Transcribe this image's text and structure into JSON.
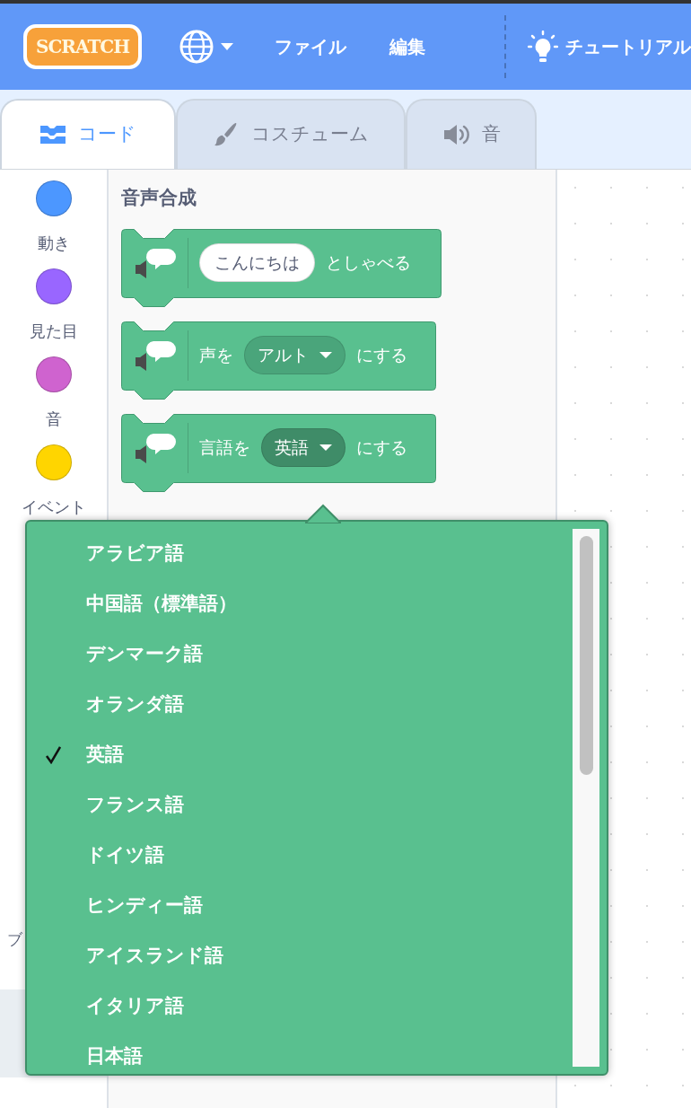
{
  "menu_bar": {
    "logo": "SCRATCH",
    "items": [
      {
        "kind": "language"
      },
      {
        "kind": "text",
        "label": "ファイル"
      },
      {
        "kind": "text",
        "label": "編集"
      },
      {
        "kind": "divider"
      },
      {
        "kind": "tutorial",
        "label": "チュートリアル"
      }
    ]
  },
  "tabs": [
    {
      "label": "コード",
      "kind": "code",
      "selected": true
    },
    {
      "label": "コスチューム",
      "kind": "costume",
      "selected": false
    },
    {
      "label": "音",
      "kind": "sound",
      "selected": false
    }
  ],
  "categories": [
    {
      "label": "動き",
      "color": "#4c97ff",
      "selected": false
    },
    {
      "label": "見た目",
      "color": "#9966ff",
      "selected": false
    },
    {
      "label": "音",
      "color": "#cf63cf",
      "selected": false
    },
    {
      "label": "イベント",
      "color": "#ffd500",
      "selected": false
    },
    {
      "label": "ブ",
      "selected": false
    },
    {
      "selected": true
    }
  ],
  "palette": {
    "title": "音声合成",
    "blocks": [
      {
        "parts": [
          {
            "kind": "input",
            "value": "こんにちは"
          },
          {
            "kind": "text",
            "text": "としゃべる"
          }
        ]
      },
      {
        "parts": [
          {
            "kind": "text",
            "text": "声を"
          },
          {
            "kind": "menu",
            "value": "アルト",
            "open": false
          },
          {
            "kind": "text",
            "text": "にする"
          }
        ]
      },
      {
        "parts": [
          {
            "kind": "text",
            "text": "言語を"
          },
          {
            "kind": "menu",
            "value": "英語",
            "open": true
          },
          {
            "kind": "text",
            "text": "にする"
          }
        ]
      }
    ]
  },
  "dropdown": {
    "items": [
      {
        "label": "アラビア語",
        "selected": false
      },
      {
        "label": "中国語（標準語）",
        "selected": false
      },
      {
        "label": "デンマーク語",
        "selected": false
      },
      {
        "label": "オランダ語",
        "selected": false
      },
      {
        "label": "英語",
        "selected": true
      },
      {
        "label": "フランス語",
        "selected": false
      },
      {
        "label": "ドイツ語",
        "selected": false
      },
      {
        "label": "ヒンディー語",
        "selected": false
      },
      {
        "label": "アイスランド語",
        "selected": false
      },
      {
        "label": "イタリア語",
        "selected": false
      },
      {
        "label": "日本語",
        "selected": false
      }
    ]
  }
}
